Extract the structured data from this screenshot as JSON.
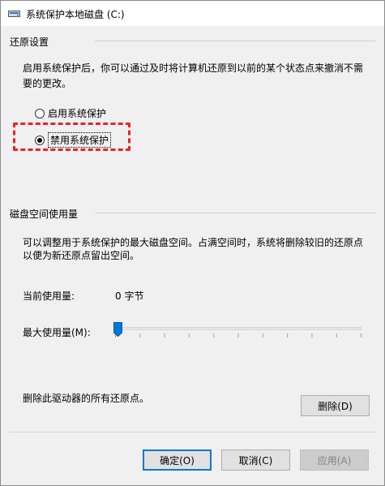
{
  "window": {
    "title": "系统保护本地磁盘 (C:)",
    "icon": "drive-icon"
  },
  "restore_settings": {
    "header": "还原设置",
    "description_line1": "启用系统保护后，你可以通过及时将计算机还原到以前的某个状态点来撤消不需",
    "description_line2": "要的更改。",
    "options": [
      {
        "label": "启用系统保护",
        "checked": false
      },
      {
        "label": "禁用系统保护",
        "checked": true
      }
    ]
  },
  "disk_usage": {
    "header": "磁盘空间使用量",
    "description_line1": "可以调整用于系统保护的最大磁盘空间。占满空间时，系统将删除较旧的还原点",
    "description_line2": "以便为新还原点留出空间。",
    "current_label": "当前使用量:",
    "current_value": "0 字节",
    "max_label": "最大使用量(M):",
    "max_fraction": 0.0
  },
  "delete_section": {
    "text": "删除此驱动器的所有还原点。",
    "button": "删除(D)"
  },
  "buttons": {
    "ok": "确定(O)",
    "cancel": "取消(C)",
    "apply": "应用(A)"
  },
  "colors": {
    "highlight_border": "#e8232b",
    "default_button_border": "#0078d7"
  }
}
